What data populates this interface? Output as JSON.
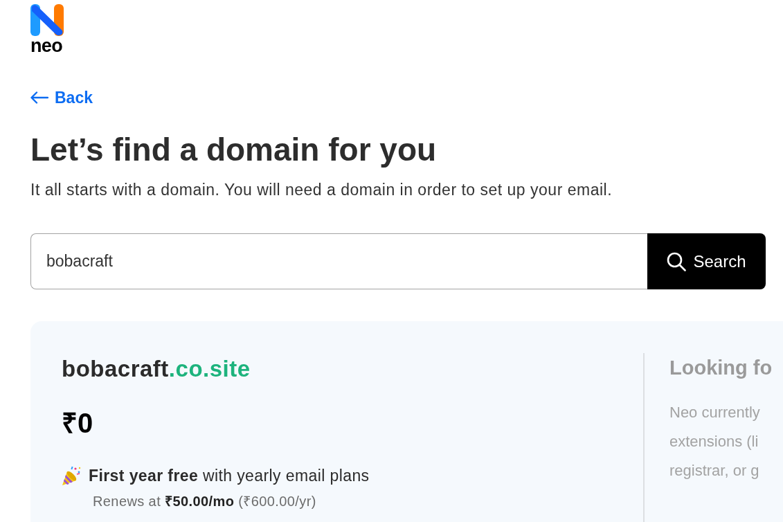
{
  "logo": {
    "wordmark": "neo"
  },
  "back_link": {
    "label": "Back"
  },
  "heading": "Let’s find a domain for you",
  "subheading": "It all starts with a domain. You will need a domain in order to set up your email.",
  "search": {
    "value": "bobacraft",
    "button": "Search"
  },
  "result": {
    "name": "bobacraft",
    "extension": ".co.site",
    "price": "₹0",
    "offer": "**First year free** with yearly email plans",
    "renewal": "Renews at **₹50.00/mo** (₹600.00/yr)"
  },
  "info_panel": {
    "title": "Looking fo",
    "lines": [
      "Neo currently",
      "extensions (li",
      "registrar, or g"
    ]
  }
}
